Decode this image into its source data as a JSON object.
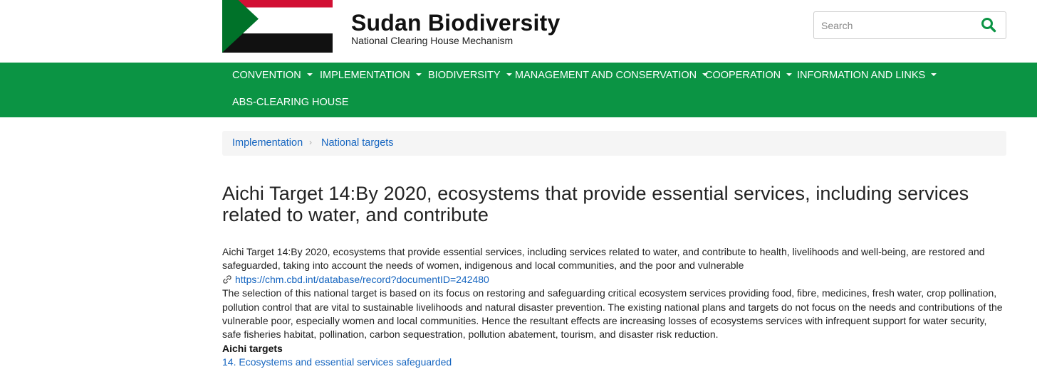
{
  "site": {
    "title": "Sudan Biodiversity",
    "subtitle": "National Clearing House Mechanism"
  },
  "search": {
    "placeholder": "Search",
    "icon": "search-icon"
  },
  "nav": {
    "items": [
      {
        "label": "CONVENTION",
        "has_dropdown": true
      },
      {
        "label": "IMPLEMENTATION",
        "has_dropdown": true
      },
      {
        "label": "BIODIVERSITY",
        "has_dropdown": true
      },
      {
        "label": "MANAGEMENT AND CONSERVATION",
        "has_dropdown": true
      },
      {
        "label": "COOPERATION",
        "has_dropdown": true
      },
      {
        "label": "INFORMATION AND LINKS",
        "has_dropdown": true
      },
      {
        "label": "ABS-CLEARING HOUSE",
        "has_dropdown": false
      }
    ]
  },
  "breadcrumb": {
    "items": [
      "Implementation",
      "National targets"
    ],
    "separator": "›"
  },
  "page": {
    "title": "Aichi Target 14:By 2020, ecosystems that provide essential services, including services related to water, and contribute",
    "summary": "Aichi Target 14:By 2020, ecosystems that provide essential services, including services related to water, and contribute to health, livelihoods and well-being, are restored and safeguarded, taking into account the needs of women, indigenous and local communities, and the poor and vulnerable",
    "link": "https://chm.cbd.int/database/record?documentID=242480",
    "description": "The selection of this national target is based on its focus on restoring and safeguarding critical ecosystem services providing food, fibre, medicines, fresh water, crop pollination, pollution control that are vital to sustainable livelihoods and natural disaster prevention. The existing national plans and targets do not focus on the needs and contributions of the vulnerable poor, especially women and local communities. Hence the resultant effects are increasing losses of ecosystems services with infrequent support for water security, safe fisheries habitat, pollination, carbon sequestration, pollution abatement, tourism, and disaster risk reduction.",
    "aichi_heading": "Aichi targets",
    "aichi_link": "14. Ecosystems and essential services safeguarded"
  },
  "colors": {
    "nav_green": "#0b9444",
    "link_blue": "#1565c0",
    "flag_red": "#d21034",
    "flag_green": "#007229",
    "flag_black": "#000000"
  }
}
